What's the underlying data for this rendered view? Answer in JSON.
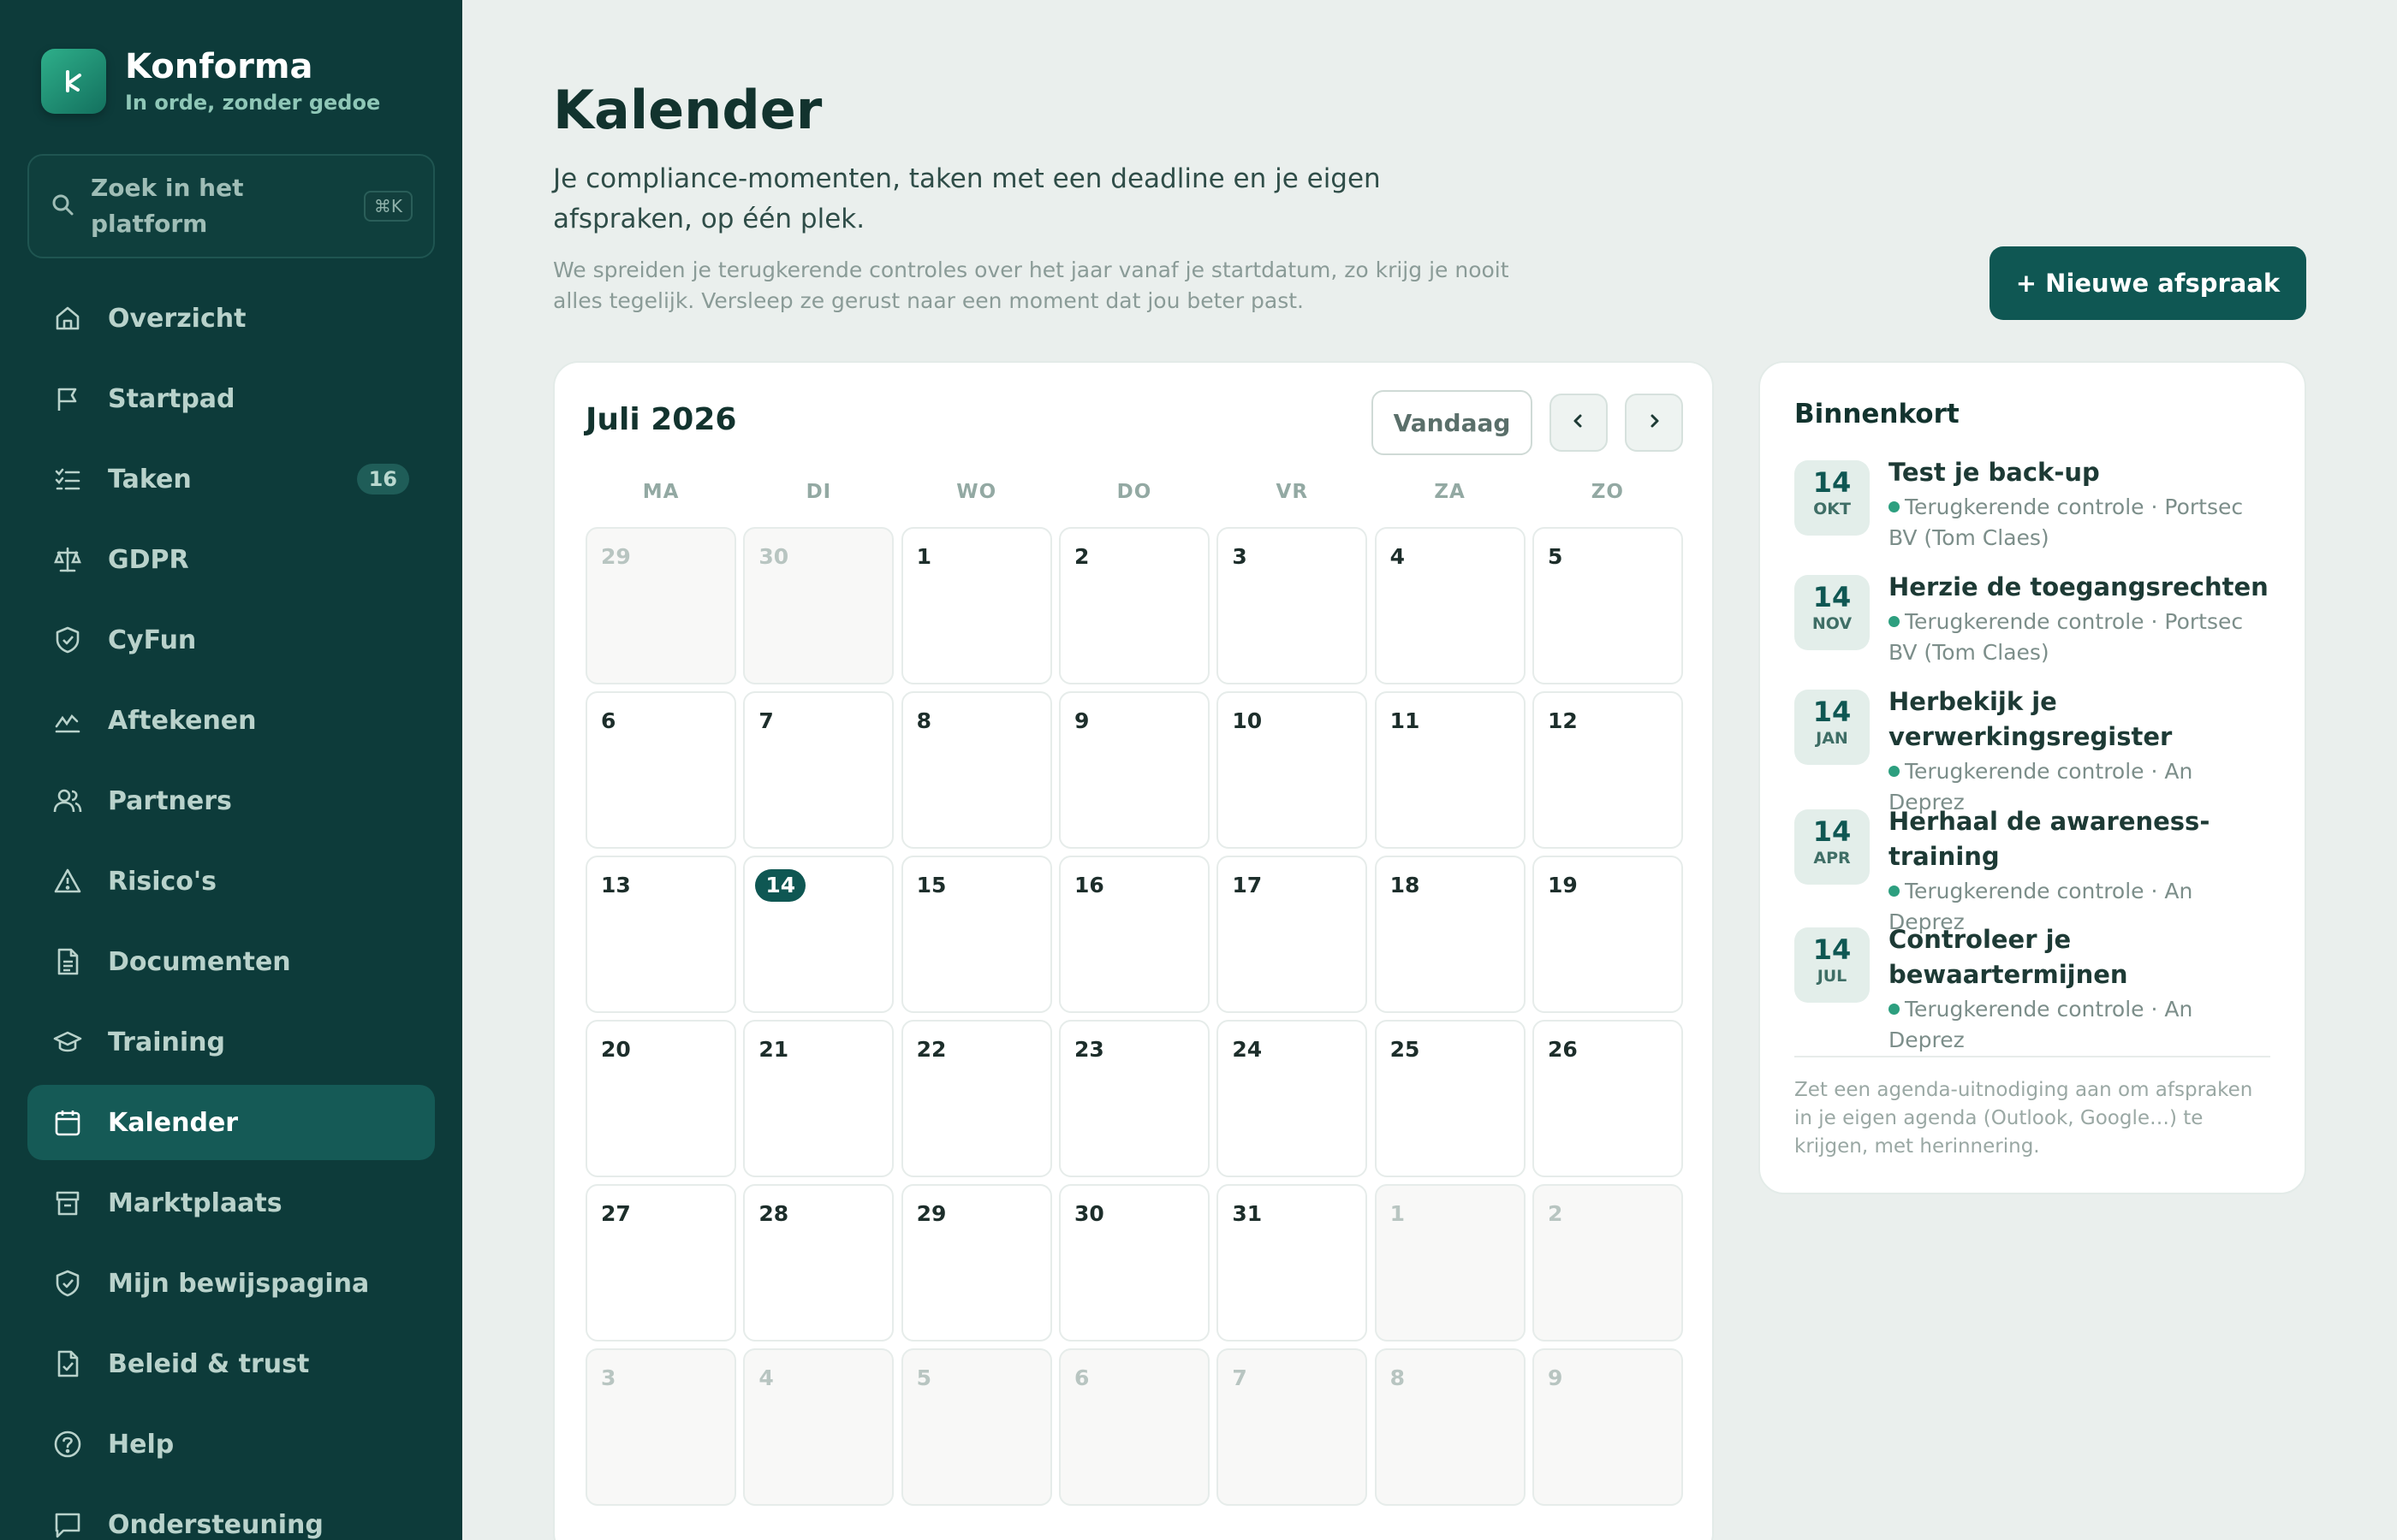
{
  "brand": {
    "name": "Konforma",
    "tagline": "In orde, zonder gedoe"
  },
  "search": {
    "placeholder": "Zoek in het platform",
    "shortcut": "⌘K"
  },
  "sidebar": {
    "items": [
      {
        "label": "Overzicht",
        "icon": "home-icon"
      },
      {
        "label": "Startpad",
        "icon": "flag-icon"
      },
      {
        "label": "Taken",
        "icon": "checklist-icon",
        "badge": "16"
      },
      {
        "label": "GDPR",
        "icon": "scale-icon"
      },
      {
        "label": "CyFun",
        "icon": "shield-icon"
      },
      {
        "label": "Aftekenen",
        "icon": "signature-icon"
      },
      {
        "label": "Partners",
        "icon": "users-icon"
      },
      {
        "label": "Risico's",
        "icon": "warning-icon"
      },
      {
        "label": "Documenten",
        "icon": "document-icon"
      },
      {
        "label": "Training",
        "icon": "graduation-cap-icon"
      },
      {
        "label": "Kalender",
        "icon": "calendar-icon",
        "active": true
      },
      {
        "label": "Marktplaats",
        "icon": "store-icon"
      },
      {
        "label": "Mijn bewijspagina",
        "icon": "shield-check-icon"
      },
      {
        "label": "Beleid & trust",
        "icon": "file-check-icon"
      },
      {
        "label": "Help",
        "icon": "help-icon"
      },
      {
        "label": "Ondersteuning",
        "icon": "chat-icon"
      }
    ]
  },
  "page": {
    "title": "Kalender",
    "subtitle": "Je compliance-momenten, taken met een deadline en je eigen afspraken, op één plek.",
    "note": "We spreiden je terugkerende controles over het jaar vanaf je startdatum, zo krijg je nooit alles tegelijk. Versleep ze gerust naar een moment dat jou beter past.",
    "new_button": "+ Nieuwe afspraak"
  },
  "calendar": {
    "month_title": "Juli 2026",
    "today_label": "Vandaag",
    "prev_label": "‹",
    "next_label": "›",
    "weekdays": [
      "MA",
      "DI",
      "WO",
      "DO",
      "VR",
      "ZA",
      "ZO"
    ],
    "days": [
      {
        "n": "29",
        "other": true
      },
      {
        "n": "30",
        "other": true
      },
      {
        "n": "1"
      },
      {
        "n": "2"
      },
      {
        "n": "3"
      },
      {
        "n": "4"
      },
      {
        "n": "5"
      },
      {
        "n": "6"
      },
      {
        "n": "7"
      },
      {
        "n": "8"
      },
      {
        "n": "9"
      },
      {
        "n": "10"
      },
      {
        "n": "11"
      },
      {
        "n": "12"
      },
      {
        "n": "13"
      },
      {
        "n": "14",
        "today": true
      },
      {
        "n": "15"
      },
      {
        "n": "16"
      },
      {
        "n": "17"
      },
      {
        "n": "18"
      },
      {
        "n": "19"
      },
      {
        "n": "20"
      },
      {
        "n": "21"
      },
      {
        "n": "22"
      },
      {
        "n": "23"
      },
      {
        "n": "24"
      },
      {
        "n": "25"
      },
      {
        "n": "26"
      },
      {
        "n": "27"
      },
      {
        "n": "28"
      },
      {
        "n": "29"
      },
      {
        "n": "30"
      },
      {
        "n": "31"
      },
      {
        "n": "1",
        "other": true
      },
      {
        "n": "2",
        "other": true
      },
      {
        "n": "3",
        "other": true
      },
      {
        "n": "4",
        "other": true
      },
      {
        "n": "5",
        "other": true
      },
      {
        "n": "6",
        "other": true
      },
      {
        "n": "7",
        "other": true
      },
      {
        "n": "8",
        "other": true
      },
      {
        "n": "9",
        "other": true
      }
    ]
  },
  "upcoming": {
    "title": "Binnenkort",
    "items": [
      {
        "day": "14",
        "month": "OKT",
        "title": "Test je back-up",
        "meta": "Terugkerende controle · Portsec BV (Tom Claes)"
      },
      {
        "day": "14",
        "month": "NOV",
        "title": "Herzie de toegangsrechten",
        "meta": "Terugkerende controle · Portsec BV (Tom Claes)"
      },
      {
        "day": "14",
        "month": "JAN",
        "title": "Herbekijk je verwerkingsregister",
        "meta": "Terugkerende controle · An Deprez"
      },
      {
        "day": "14",
        "month": "APR",
        "title": "Herhaal de awareness-training",
        "meta": "Terugkerende controle · An Deprez"
      },
      {
        "day": "14",
        "month": "JUL",
        "title": "Controleer je bewaartermijnen",
        "meta": "Terugkerende controle · An Deprez"
      }
    ],
    "footer": "Zet een agenda-uitnodiging aan om afspraken in je eigen agenda (Outlook, Google…) te krijgen, met herinnering."
  },
  "colors": {
    "sidebar": "#0d3b3a",
    "accent": "#0f5753",
    "active_nav": "#155a56",
    "background": "#eaefed"
  }
}
